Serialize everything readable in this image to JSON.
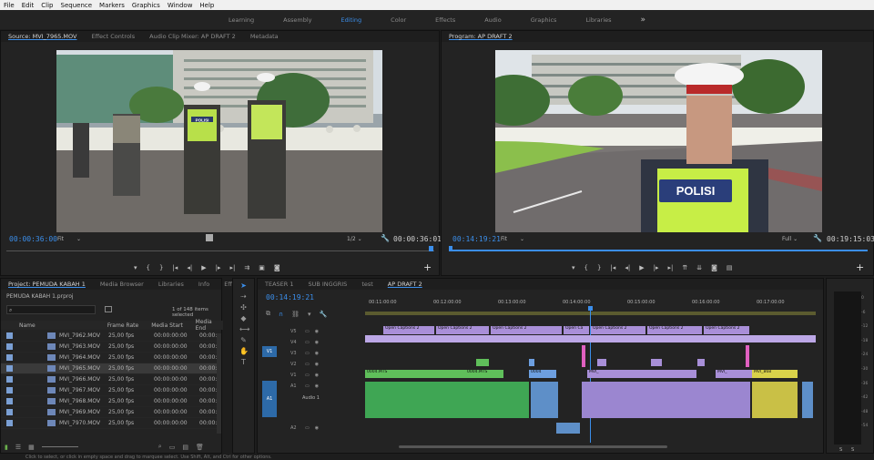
{
  "menu": [
    "File",
    "Edit",
    "Clip",
    "Sequence",
    "Markers",
    "Graphics",
    "Window",
    "Help"
  ],
  "workspaces": [
    "Learning",
    "Assembly",
    "Editing",
    "Color",
    "Effects",
    "Audio",
    "Graphics",
    "Libraries"
  ],
  "workspace_more": "»",
  "source": {
    "tabs": [
      "Source: MVI_7965.MOV",
      "Effect Controls",
      "Audio Clip Mixer: AP DRAFT 2",
      "Metadata"
    ],
    "timecode": "00:00:36:00",
    "fit": "Fit",
    "resolution": "1/2",
    "duration": "00:00:36:01"
  },
  "program": {
    "tab": "Program: AP DRAFT 2",
    "timecode": "00:14:19:21",
    "fit": "Fit",
    "resolution": "Full",
    "duration": "00:19:15:03",
    "vest_text": "POLISI"
  },
  "source_vest_text": "POLISI",
  "project": {
    "tabs": [
      "Project: PEMUDA KABAH 1",
      "Media Browser",
      "Libraries",
      "Info",
      "Effe"
    ],
    "file": "PEMUDA KABAH 1.prproj",
    "selection": "1 of 148 items selected",
    "columns": [
      "Name",
      "Frame Rate",
      "Media Start",
      "Media End"
    ],
    "rows": [
      {
        "name": "MVI_7962.MOV",
        "fps": "25,00 fps",
        "start": "00:00:00:00",
        "end": "00:00:"
      },
      {
        "name": "MVI_7963.MOV",
        "fps": "25,00 fps",
        "start": "00:00:00:00",
        "end": "00:00:"
      },
      {
        "name": "MVI_7964.MOV",
        "fps": "25,00 fps",
        "start": "00:00:00:00",
        "end": "00:00:"
      },
      {
        "name": "MVI_7965.MOV",
        "fps": "25,00 fps",
        "start": "00:00:00:00",
        "end": "00:00:"
      },
      {
        "name": "MVI_7966.MOV",
        "fps": "25,00 fps",
        "start": "00:00:00:00",
        "end": "00:00:"
      },
      {
        "name": "MVI_7967.MOV",
        "fps": "25,00 fps",
        "start": "00:00:00:00",
        "end": "00:00:"
      },
      {
        "name": "MVI_7968.MOV",
        "fps": "25,00 fps",
        "start": "00:00:00:00",
        "end": "00:00:"
      },
      {
        "name": "MVI_7969.MOV",
        "fps": "25,00 fps",
        "start": "00:00:00:00",
        "end": "00:00:"
      },
      {
        "name": "MVI_7970.MOV",
        "fps": "25,00 fps",
        "start": "00:00:00:00",
        "end": "00:00:"
      }
    ],
    "selected_index": 3
  },
  "timeline": {
    "tabs": [
      "TEASER 1",
      "SUB INGGRIS",
      "test",
      "AP DRAFT 2"
    ],
    "timecode": "00:14:19:21",
    "ruler": [
      "00:11:00:00",
      "00:12:00:00",
      "00:13:00:00",
      "00:14:00:00",
      "00:15:00:00",
      "00:16:00:00",
      "00:17:00:00"
    ],
    "tracks": [
      "V5",
      "V4",
      "V3",
      "V2",
      "V1",
      "A1",
      "A2"
    ],
    "src_v": "V1",
    "src_a": "A1",
    "audio_label": "Audio 1",
    "caption_clips": [
      "Open Captions 2",
      "Open Captions 2",
      "Open Captions 2",
      "Open Ca",
      "Open Captions 2",
      "Open Captions 2",
      "Open Captions 2"
    ],
    "v1_clips": [
      "0004.MTS",
      "0004.MTS",
      "0004",
      "MVI_",
      "MVI_",
      "MVI_868",
      "MVI_7962"
    ]
  },
  "meter": {
    "ticks": [
      "0",
      "-6",
      "-12",
      "-18",
      "-24",
      "-30",
      "-36",
      "-42",
      "-48",
      "-54"
    ],
    "bottom": [
      "S",
      "S"
    ],
    "db": "dB"
  },
  "status": "Click to select, or click in empty space and drag to marquee select. Use Shift, Alt, and Ctrl for other options."
}
